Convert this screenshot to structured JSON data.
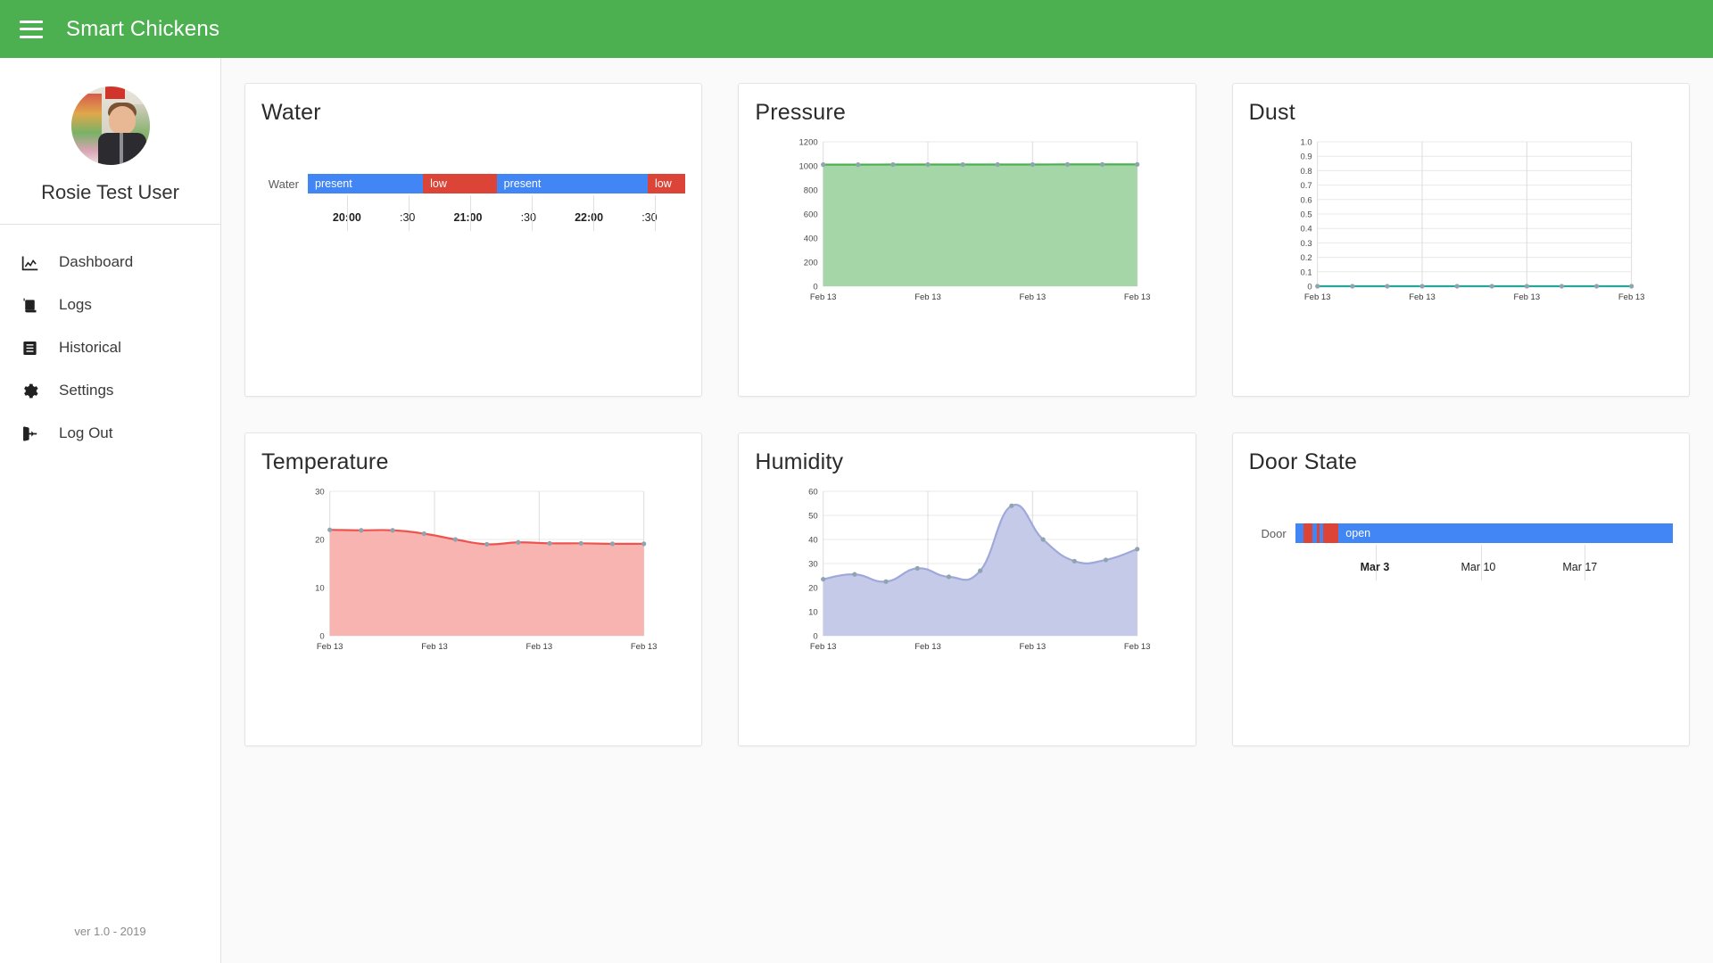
{
  "header": {
    "title": "Smart Chickens",
    "menu_icon": "hamburger-menu-icon",
    "bg_color": "#4CAF50"
  },
  "sidebar": {
    "user_name": "Rosie Test User",
    "avatar_alt": "user-avatar-photo",
    "footer": "ver 1.0 - 2019",
    "items": [
      {
        "label": "Dashboard",
        "icon": "chart-line-icon"
      },
      {
        "label": "Logs",
        "icon": "clipboard-list-icon"
      },
      {
        "label": "Historical",
        "icon": "book-icon"
      },
      {
        "label": "Settings",
        "icon": "gear-icon"
      },
      {
        "label": "Log Out",
        "icon": "sign-out-icon"
      }
    ]
  },
  "cards": [
    {
      "title": "Water"
    },
    {
      "title": "Pressure"
    },
    {
      "title": "Dust"
    },
    {
      "title": "Temperature"
    },
    {
      "title": "Humidity"
    },
    {
      "title": "Door State"
    }
  ],
  "chart_data": [
    {
      "type": "table",
      "title": "Water",
      "chart_kind": "state-timeline",
      "row_label": "Water",
      "xlabel": "",
      "ylabel": "",
      "colors": {
        "present": "#4285F4",
        "low": "#DB4437"
      },
      "x_ticks": [
        "20:00",
        ":30",
        "21:00",
        ":30",
        "22:00",
        ":30"
      ],
      "x_tick_major": [
        true,
        false,
        true,
        false,
        true,
        false
      ],
      "segments": [
        {
          "state": "present",
          "start_pct": 0,
          "width_pct": 30.5,
          "color": "#4285F4"
        },
        {
          "state": "low",
          "start_pct": 30.5,
          "width_pct": 19.5,
          "color": "#DB4437"
        },
        {
          "state": "present",
          "start_pct": 50,
          "width_pct": 40,
          "color": "#4285F4"
        },
        {
          "state": "low",
          "start_pct": 90,
          "width_pct": 10,
          "color": "#DB4437"
        }
      ]
    },
    {
      "type": "area",
      "title": "Pressure",
      "xlabel": "",
      "ylabel": "",
      "ylim": [
        0,
        1200
      ],
      "y_ticks": [
        0,
        200,
        400,
        600,
        800,
        1000,
        1200
      ],
      "x_ticks": [
        "Feb 13",
        "Feb 13",
        "Feb 13",
        "Feb 13"
      ],
      "grid": true,
      "line_color": "#4CAF50",
      "fill_color": "#A5D6A7",
      "point_color": "#90A4AE",
      "x": [
        0,
        1,
        2,
        3,
        4,
        5,
        6,
        7,
        8,
        9
      ],
      "values": [
        1010,
        1010,
        1011,
        1011,
        1011,
        1011,
        1011,
        1012,
        1012,
        1012
      ]
    },
    {
      "type": "line",
      "title": "Dust",
      "xlabel": "",
      "ylabel": "",
      "ylim": [
        0,
        1.0
      ],
      "y_ticks": [
        0,
        0.1,
        0.2,
        0.3,
        0.4,
        0.5,
        0.6,
        0.7,
        0.8,
        0.9,
        1.0
      ],
      "y_tick_labels": [
        "0",
        "0.1",
        "0.2",
        "0.3",
        "0.4",
        "0.5",
        "0.6",
        "0.7",
        "0.8",
        "0.9",
        "1.0"
      ],
      "x_ticks": [
        "Feb 13",
        "Feb 13",
        "Feb 13",
        "Feb 13"
      ],
      "grid": true,
      "line_color": "#26A69A",
      "point_color": "#90A4AE",
      "x": [
        0,
        1,
        2,
        3,
        4,
        5,
        6,
        7,
        8,
        9
      ],
      "values": [
        0,
        0,
        0,
        0,
        0,
        0,
        0,
        0,
        0,
        0
      ]
    },
    {
      "type": "area",
      "title": "Temperature",
      "xlabel": "",
      "ylabel": "",
      "ylim": [
        0,
        30
      ],
      "y_ticks": [
        0,
        10,
        20,
        30
      ],
      "x_ticks": [
        "Feb 13",
        "Feb 13",
        "Feb 13",
        "Feb 13"
      ],
      "grid": true,
      "line_color": "#EF5350",
      "fill_color": "#F8B4B0",
      "point_color": "#90A4AE",
      "x": [
        0,
        1,
        2,
        3,
        4,
        5,
        6,
        7,
        8,
        9,
        10
      ],
      "values": [
        22.0,
        21.9,
        21.9,
        21.2,
        20.0,
        19.0,
        19.4,
        19.2,
        19.2,
        19.1,
        19.1
      ]
    },
    {
      "type": "area",
      "title": "Humidity",
      "xlabel": "",
      "ylabel": "",
      "ylim": [
        0,
        60
      ],
      "y_ticks": [
        0,
        10,
        20,
        30,
        40,
        50,
        60
      ],
      "x_ticks": [
        "Feb 13",
        "Feb 13",
        "Feb 13",
        "Feb 13"
      ],
      "grid": true,
      "line_color": "#9FA8DA",
      "fill_color": "#C5CAE9",
      "point_color": "#90A4AE",
      "x": [
        0,
        1,
        2,
        3,
        4,
        5,
        6,
        7,
        8,
        9,
        10
      ],
      "values": [
        23.5,
        25.5,
        22.5,
        28.0,
        24.5,
        27.0,
        54.0,
        40.0,
        31.0,
        31.5,
        36.0
      ]
    },
    {
      "type": "table",
      "title": "Door State",
      "chart_kind": "state-timeline",
      "row_label": "Door",
      "xlabel": "",
      "ylabel": "",
      "colors": {
        "open": "#4285F4",
        "closed": "#DB4437"
      },
      "x_ticks": [
        "Mar 3",
        "Mar 10",
        "Mar 17"
      ],
      "x_tick_major": [
        true,
        false,
        false
      ],
      "x_tick_pct": [
        19.5,
        48.0,
        76.0
      ],
      "segments": [
        {
          "state": "open",
          "start_pct": 0.0,
          "width_pct": 2.2,
          "color": "#4285F4"
        },
        {
          "state": "closed",
          "start_pct": 2.2,
          "width_pct": 2.3,
          "color": "#DB4437"
        },
        {
          "state": "open",
          "start_pct": 4.5,
          "width_pct": 1.2,
          "color": "#4285F4"
        },
        {
          "state": "closed",
          "start_pct": 5.7,
          "width_pct": 0.8,
          "color": "#DB4437"
        },
        {
          "state": "open",
          "start_pct": 6.5,
          "width_pct": 1.0,
          "color": "#4285F4"
        },
        {
          "state": "closed",
          "start_pct": 7.5,
          "width_pct": 4.0,
          "color": "#DB4437"
        },
        {
          "state": "open",
          "start_pct": 11.5,
          "width_pct": 88.5,
          "color": "#4285F4"
        }
      ]
    }
  ]
}
